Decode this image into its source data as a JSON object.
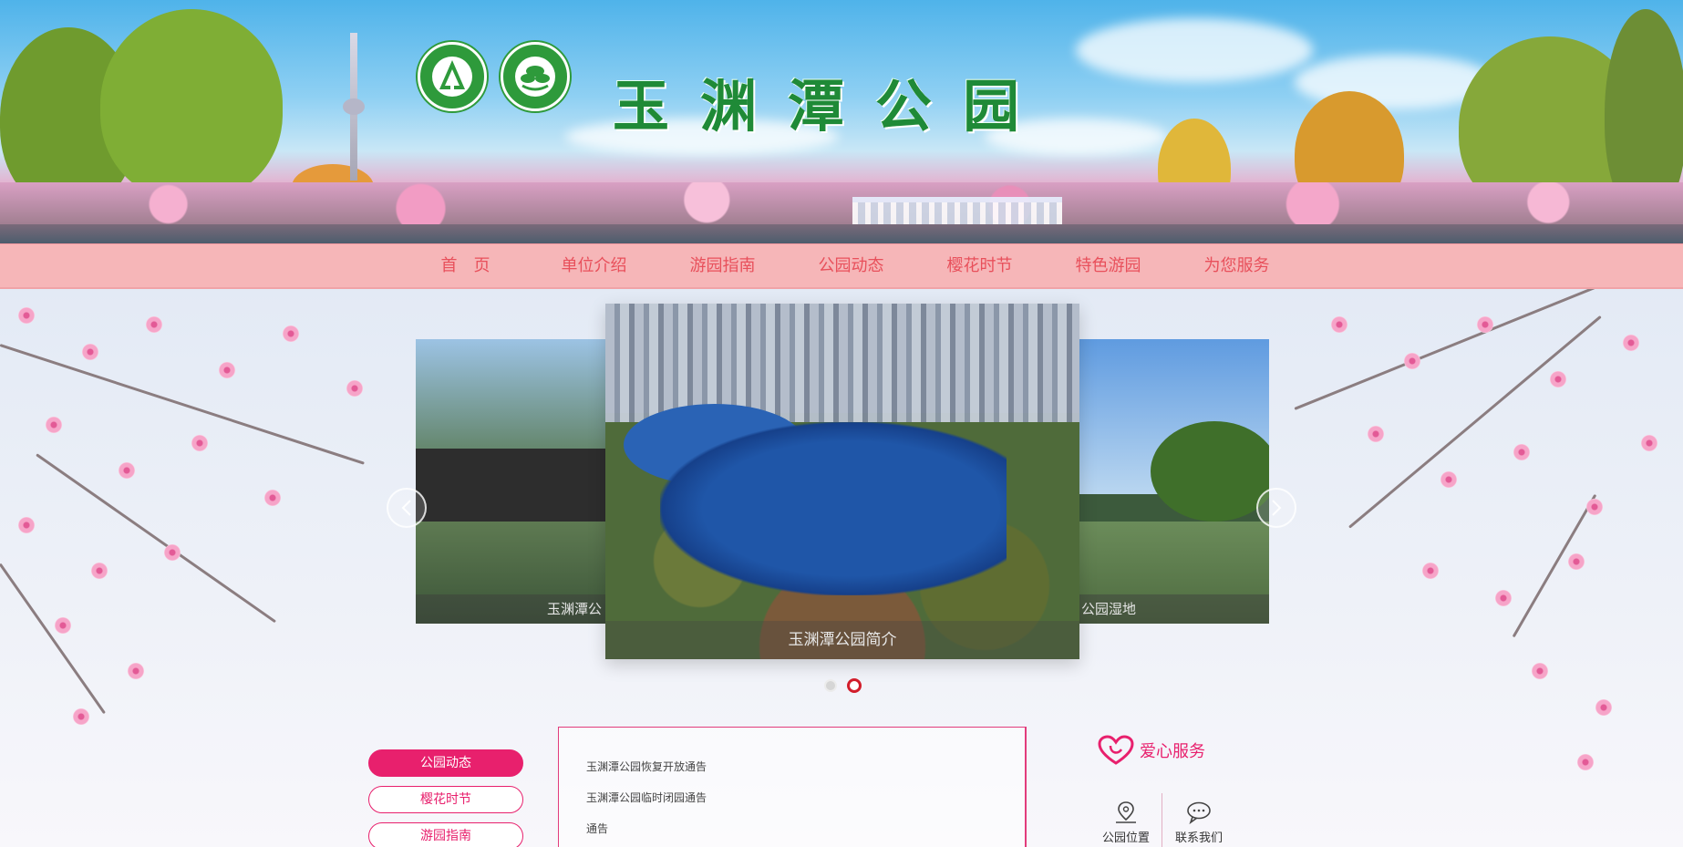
{
  "header": {
    "title_chars": [
      "玉",
      "渊",
      "潭",
      "公",
      "园"
    ],
    "logo_icons": [
      "tree-emblem-icon",
      "flower-emblem-icon"
    ]
  },
  "nav": {
    "items": [
      "首　页",
      "单位介绍",
      "游园指南",
      "公园动态",
      "樱花时节",
      "特色游园",
      "为您服务"
    ]
  },
  "carousel": {
    "left_caption": "玉渊潭公",
    "main_caption": "玉渊潭公园简介",
    "right_caption": "公园湿地",
    "slide_count": 2,
    "active_index": 1,
    "prev_icon": "chevron-left-icon",
    "next_icon": "chevron-right-icon"
  },
  "tabs": {
    "items": [
      "公园动态",
      "樱花时节",
      "游园指南"
    ],
    "active_index": 0
  },
  "news": {
    "items": [
      "玉渊潭公园恢复开放通告",
      "玉渊潭公园临时闭园通告",
      "通告"
    ]
  },
  "service": {
    "title": "爱心服务",
    "title_icon": "heart-icon",
    "items": [
      {
        "label": "公园位置",
        "icon": "map-pin-icon"
      },
      {
        "label": "联系我们",
        "icon": "chat-bubble-icon"
      }
    ]
  },
  "colors": {
    "accent": "#e8206d",
    "nav_bg": "#f6b6b8",
    "nav_text": "#e8505b",
    "title_green": "#1f8a37",
    "active_dot": "#d21d2b"
  }
}
